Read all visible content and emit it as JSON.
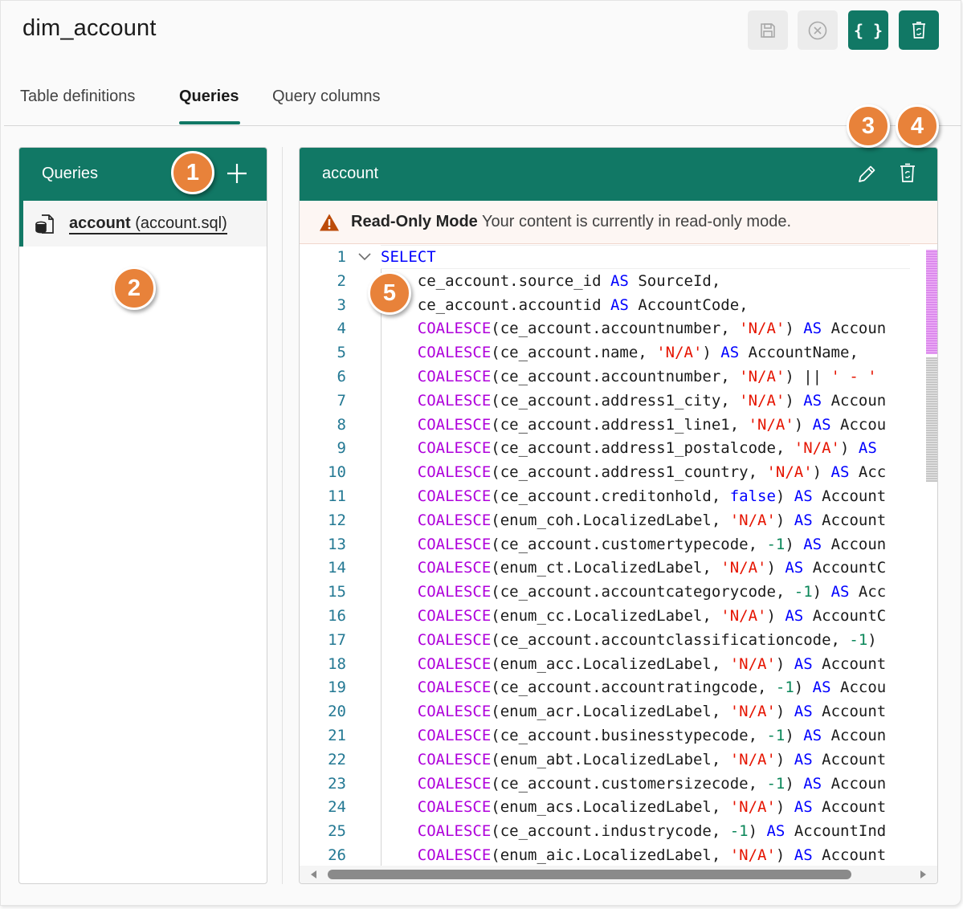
{
  "header": {
    "title": "dim_account"
  },
  "toolbar": [
    {
      "name": "save-button",
      "icon": "save-icon",
      "enabled": false
    },
    {
      "name": "cancel-button",
      "icon": "close-circle-icon",
      "enabled": false
    },
    {
      "name": "json-view-button",
      "icon": "braces-icon",
      "label": "{ }",
      "enabled": true
    },
    {
      "name": "delete-table-button",
      "icon": "trash-icon",
      "enabled": true
    }
  ],
  "tabs": [
    {
      "label": "Table definitions",
      "active": false
    },
    {
      "label": "Queries",
      "active": true
    },
    {
      "label": "Query columns",
      "active": false
    }
  ],
  "queries_panel": {
    "title": "Queries",
    "add_icon": "plus-icon",
    "items": [
      {
        "name": "account",
        "file": "(account.sql)",
        "icon": "sql-file-icon",
        "selected": true
      }
    ]
  },
  "editor_panel": {
    "title": "account",
    "edit_icon": "pencil-icon",
    "delete_icon": "trash-icon",
    "banner": {
      "icon": "warning-icon",
      "title": "Read-Only Mode",
      "message": "Your content is currently in read-only mode."
    },
    "code_lines": [
      "SELECT",
      "    ce_account.source_id AS SourceId,",
      "    ce_account.accountid AS AccountCode,",
      "    COALESCE(ce_account.accountnumber, 'N/A') AS Accoun",
      "    COALESCE(ce_account.name, 'N/A') AS AccountName,",
      "    COALESCE(ce_account.accountnumber, 'N/A') || ' - '",
      "    COALESCE(ce_account.address1_city, 'N/A') AS Accoun",
      "    COALESCE(ce_account.address1_line1, 'N/A') AS Accou",
      "    COALESCE(ce_account.address1_postalcode, 'N/A') AS",
      "    COALESCE(ce_account.address1_country, 'N/A') AS Acc",
      "    COALESCE(ce_account.creditonhold, false) AS Account",
      "    COALESCE(enum_coh.LocalizedLabel, 'N/A') AS Account",
      "    COALESCE(ce_account.customertypecode, -1) AS Accoun",
      "    COALESCE(enum_ct.LocalizedLabel, 'N/A') AS AccountC",
      "    COALESCE(ce_account.accountcategorycode, -1) AS Acc",
      "    COALESCE(enum_cc.LocalizedLabel, 'N/A') AS AccountC",
      "    COALESCE(ce_account.accountclassificationcode, -1)",
      "    COALESCE(enum_acc.LocalizedLabel, 'N/A') AS Account",
      "    COALESCE(ce_account.accountratingcode, -1) AS Accou",
      "    COALESCE(enum_acr.LocalizedLabel, 'N/A') AS Account",
      "    COALESCE(ce_account.businesstypecode, -1) AS Accoun",
      "    COALESCE(enum_abt.LocalizedLabel, 'N/A') AS Account",
      "    COALESCE(ce_account.customersizecode, -1) AS Accoun",
      "    COALESCE(enum_acs.LocalizedLabel, 'N/A') AS Account",
      "    COALESCE(ce_account.industrycode, -1) AS AccountInd",
      "    COALESCE(enum_aic.LocalizedLabel, 'N/A') AS Account"
    ]
  },
  "callouts": [
    "1",
    "2",
    "3",
    "4",
    "5"
  ],
  "colors": {
    "accent": "#117865",
    "callout": "#e8823a",
    "keyword": "#0000ff",
    "function": "#af00db",
    "string": "#e51400",
    "number": "#098658"
  }
}
